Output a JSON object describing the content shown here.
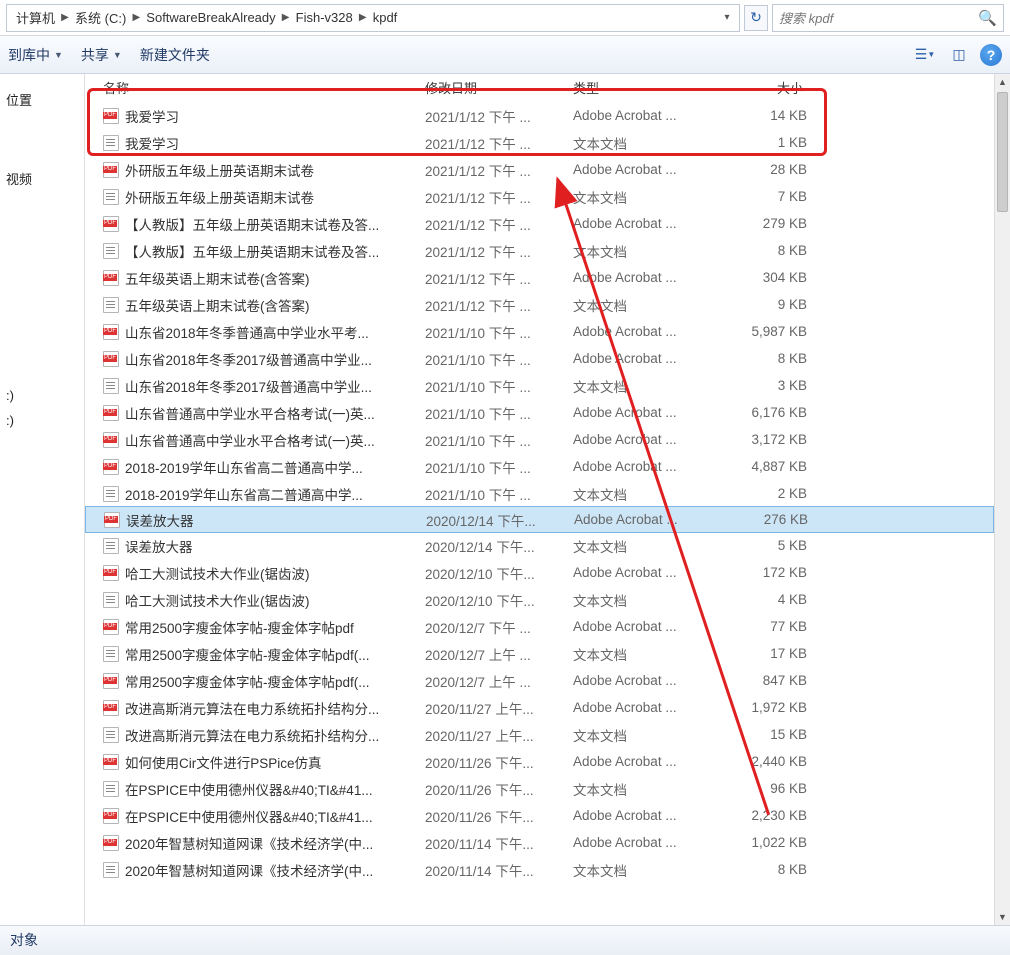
{
  "breadcrumbs": [
    "计算机",
    "系统 (C:)",
    "SoftwareBreakAlready",
    "Fish-v328",
    "kpdf"
  ],
  "search_placeholder": "搜索 kpdf",
  "toolbar": {
    "include": "到库中",
    "share": "共享",
    "newfolder": "新建文件夹"
  },
  "sidebar": {
    "loc": "位置",
    "vid": "视频",
    "c": ":)",
    "d": ":)"
  },
  "columns": {
    "name": "名称",
    "date": "修改日期",
    "type": "类型",
    "size": "大小"
  },
  "status": "对象",
  "files": [
    {
      "icon": "pdf",
      "name": "我爱学习",
      "date": "2021/1/12 下午 ...",
      "type": "Adobe Acrobat ...",
      "size": "14 KB"
    },
    {
      "icon": "txt",
      "name": "我爱学习",
      "date": "2021/1/12 下午 ...",
      "type": "文本文档",
      "size": "1 KB"
    },
    {
      "icon": "pdf",
      "name": "外研版五年级上册英语期末试卷",
      "date": "2021/1/12 下午 ...",
      "type": "Adobe Acrobat ...",
      "size": "28 KB"
    },
    {
      "icon": "txt",
      "name": "外研版五年级上册英语期末试卷",
      "date": "2021/1/12 下午 ...",
      "type": "文本文档",
      "size": "7 KB"
    },
    {
      "icon": "pdf",
      "name": "【人教版】五年级上册英语期末试卷及答...",
      "date": "2021/1/12 下午 ...",
      "type": "Adobe Acrobat ...",
      "size": "279 KB"
    },
    {
      "icon": "txt",
      "name": "【人教版】五年级上册英语期末试卷及答...",
      "date": "2021/1/12 下午 ...",
      "type": "文本文档",
      "size": "8 KB"
    },
    {
      "icon": "pdf",
      "name": "五年级英语上期末试卷(含答案)",
      "date": "2021/1/12 下午 ...",
      "type": "Adobe Acrobat ...",
      "size": "304 KB"
    },
    {
      "icon": "txt",
      "name": "五年级英语上期末试卷(含答案)",
      "date": "2021/1/12 下午 ...",
      "type": "文本文档",
      "size": "9 KB"
    },
    {
      "icon": "pdf",
      "name": "山东省2018年冬季普通高中学业水平考...",
      "date": "2021/1/10 下午 ...",
      "type": "Adobe Acrobat ...",
      "size": "5,987 KB"
    },
    {
      "icon": "pdf",
      "name": "山东省2018年冬季2017级普通高中学业...",
      "date": "2021/1/10 下午 ...",
      "type": "Adobe Acrobat ...",
      "size": "8 KB"
    },
    {
      "icon": "txt",
      "name": "山东省2018年冬季2017级普通高中学业...",
      "date": "2021/1/10 下午 ...",
      "type": "文本文档",
      "size": "3 KB"
    },
    {
      "icon": "pdf",
      "name": "山东省普通高中学业水平合格考试(一)英...",
      "date": "2021/1/10 下午 ...",
      "type": "Adobe Acrobat ...",
      "size": "6,176 KB"
    },
    {
      "icon": "pdf",
      "name": "山东省普通高中学业水平合格考试(一)英...",
      "date": "2021/1/10 下午 ...",
      "type": "Adobe Acrobat ...",
      "size": "3,172 KB"
    },
    {
      "icon": "pdf",
      "name": "2018-2019学年山东省高二普通高中学...",
      "date": "2021/1/10 下午 ...",
      "type": "Adobe Acrobat ...",
      "size": "4,887 KB"
    },
    {
      "icon": "txt",
      "name": "2018-2019学年山东省高二普通高中学...",
      "date": "2021/1/10 下午 ...",
      "type": "文本文档",
      "size": "2 KB"
    },
    {
      "icon": "pdf",
      "name": "误差放大器",
      "date": "2020/12/14 下午...",
      "type": "Adobe Acrobat ...",
      "size": "276 KB",
      "selected": true
    },
    {
      "icon": "txt",
      "name": "误差放大器",
      "date": "2020/12/14 下午...",
      "type": "文本文档",
      "size": "5 KB"
    },
    {
      "icon": "pdf",
      "name": "哈工大测试技术大作业(锯齿波)",
      "date": "2020/12/10 下午...",
      "type": "Adobe Acrobat ...",
      "size": "172 KB"
    },
    {
      "icon": "txt",
      "name": "哈工大测试技术大作业(锯齿波)",
      "date": "2020/12/10 下午...",
      "type": "文本文档",
      "size": "4 KB"
    },
    {
      "icon": "pdf",
      "name": "常用2500字瘦金体字帖-瘦金体字帖pdf",
      "date": "2020/12/7 下午 ...",
      "type": "Adobe Acrobat ...",
      "size": "77 KB"
    },
    {
      "icon": "txt",
      "name": "常用2500字瘦金体字帖-瘦金体字帖pdf(...",
      "date": "2020/12/7 上午 ...",
      "type": "文本文档",
      "size": "17 KB"
    },
    {
      "icon": "pdf",
      "name": "常用2500字瘦金体字帖-瘦金体字帖pdf(...",
      "date": "2020/12/7 上午 ...",
      "type": "Adobe Acrobat ...",
      "size": "847 KB"
    },
    {
      "icon": "pdf",
      "name": "改进高斯消元算法在电力系统拓扑结构分...",
      "date": "2020/11/27 上午...",
      "type": "Adobe Acrobat ...",
      "size": "1,972 KB"
    },
    {
      "icon": "txt",
      "name": "改进高斯消元算法在电力系统拓扑结构分...",
      "date": "2020/11/27 上午...",
      "type": "文本文档",
      "size": "15 KB"
    },
    {
      "icon": "pdf",
      "name": "如何使用Cir文件进行PSPice仿真",
      "date": "2020/11/26 下午...",
      "type": "Adobe Acrobat ...",
      "size": "2,440 KB"
    },
    {
      "icon": "txt",
      "name": "在PSPICE中使用德州仪器&#40;TI&#41...",
      "date": "2020/11/26 下午...",
      "type": "文本文档",
      "size": "96 KB"
    },
    {
      "icon": "pdf",
      "name": "在PSPICE中使用德州仪器&#40;TI&#41...",
      "date": "2020/11/26 下午...",
      "type": "Adobe Acrobat ...",
      "size": "2,230 KB"
    },
    {
      "icon": "pdf",
      "name": "2020年智慧树知道网课《技术经济学(中...",
      "date": "2020/11/14 下午...",
      "type": "Adobe Acrobat ...",
      "size": "1,022 KB"
    },
    {
      "icon": "txt",
      "name": "2020年智慧树知道网课《技术经济学(中...",
      "date": "2020/11/14 下午...",
      "type": "文本文档",
      "size": "8 KB"
    }
  ]
}
